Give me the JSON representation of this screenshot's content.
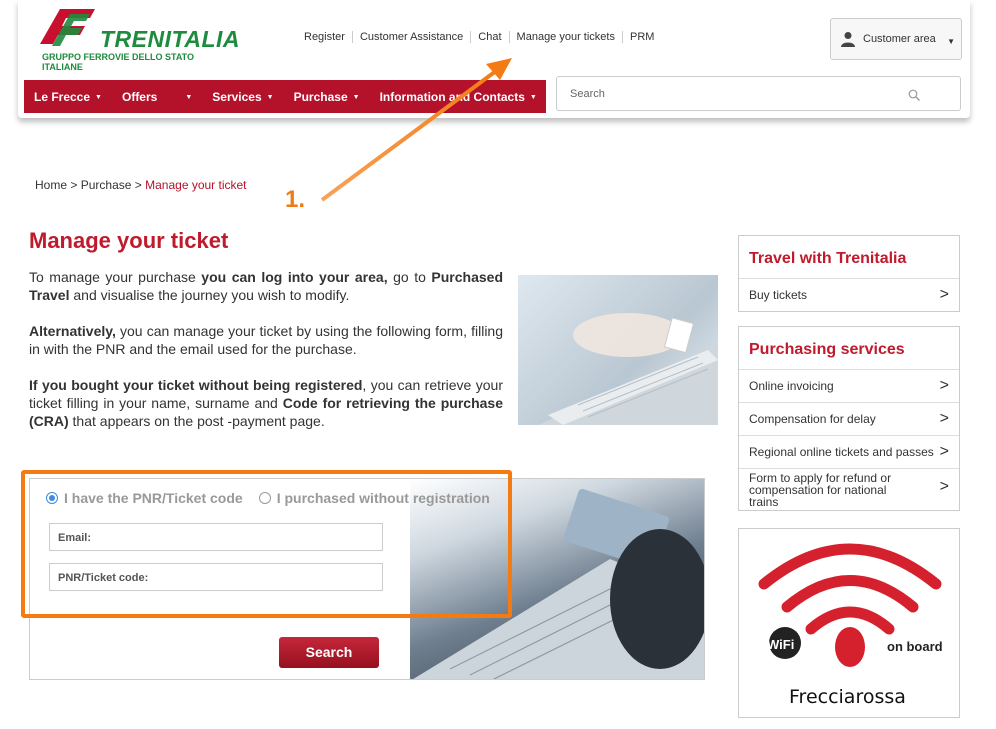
{
  "header": {
    "logo_text": "TRENITALIA",
    "logo_sub": "GRUPPO FERROVIE DELLO STATO ITALIANE",
    "top_links": [
      "Register",
      "Customer Assistance",
      "Chat",
      "Manage your tickets",
      "PRM"
    ],
    "customer_area": "Customer area",
    "nav": [
      "Le Frecce",
      "Offers",
      "Services",
      "Purchase",
      "Information and Contacts"
    ],
    "search_placeholder": "Search"
  },
  "breadcrumb": {
    "home": "Home",
    "sep": ">",
    "purchase": "Purchase",
    "current": "Manage your ticket"
  },
  "annotation": "1.",
  "main": {
    "title": "Manage your ticket",
    "p1": {
      "a": "To manage your purchase ",
      "b": "you can log into your area,",
      "c": " go to ",
      "d": "Purchased Travel",
      "e": " and visualise the journey you wish to modify."
    },
    "p2": {
      "a": "Alternatively,",
      "b": " you can manage your ticket by using the following form, filling in with the PNR and the email used for the purchase."
    },
    "p3": {
      "a": "If you bought your ticket without being registered",
      "b": ", you can retrieve your ticket filling in your name, surname and ",
      "c": "Code for retrieving the purchase (CRA)",
      "d": " that appears on the post -payment page."
    }
  },
  "form": {
    "radio_pnr": "I have the PNR/Ticket code",
    "radio_noreg": "I purchased without registration",
    "email_label": "Email:",
    "pnr_label": "PNR/Ticket code:",
    "search_button": "Search"
  },
  "sidebar": {
    "travel_title": "Travel with Trenitalia",
    "travel_items": [
      "Buy tickets"
    ],
    "purchasing_title": "Purchasing services",
    "purchasing_items": [
      "Online invoicing",
      "Compensation for delay",
      "Regional online tickets and passes",
      "Form to apply for refund or compensation for national trains"
    ],
    "promo": {
      "wifi": "WiFi",
      "onboard": "on board",
      "brand": "Frecciarossa"
    }
  },
  "colors": {
    "brand_red": "#b3122a",
    "brand_green": "#1e8b3e",
    "annotation_orange": "#f47a12"
  }
}
